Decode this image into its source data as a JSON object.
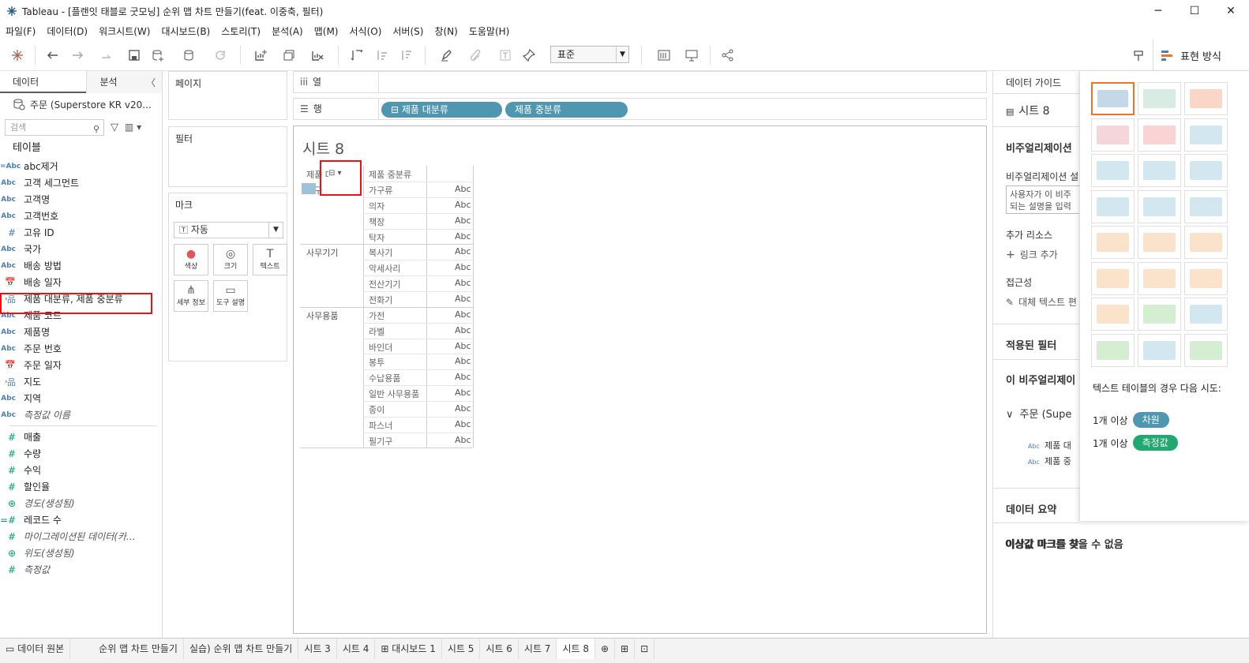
{
  "window": {
    "title": "Tableau - [플랜잇 태블로 굿모닝] 순위 맵 차트 만들기(feat. 이중축, 필터)",
    "controls": [
      "─",
      "☐",
      "✕"
    ]
  },
  "menu": [
    "파일(F)",
    "데이터(D)",
    "워크시트(W)",
    "대시보드(B)",
    "스토리(T)",
    "분석(A)",
    "맵(M)",
    "서식(O)",
    "서버(S)",
    "창(N)",
    "도움말(H)"
  ],
  "toolbar": {
    "fit_value": "표준",
    "show_me_label": "표현 방식"
  },
  "data_pane": {
    "tab_data": "데이터",
    "tab_analysis": "분석",
    "collapse": "〈",
    "datasource": "주문 (Superstore KR v20...",
    "search_placeholder": "검색",
    "tables_header": "테이블",
    "fields": [
      {
        "icon": "=Abc",
        "name": "abc제거",
        "kind": "dim"
      },
      {
        "icon": "Abc",
        "name": "고객 세그먼트",
        "kind": "dim"
      },
      {
        "icon": "Abc",
        "name": "고객명",
        "kind": "dim"
      },
      {
        "icon": "Abc",
        "name": "고객번호",
        "kind": "dim"
      },
      {
        "icon": "#",
        "name": "고유 ID",
        "kind": "dimnum"
      },
      {
        "icon": "Abc",
        "name": "국가",
        "kind": "dim"
      },
      {
        "icon": "Abc",
        "name": "배송 방법",
        "kind": "dim"
      },
      {
        "icon": "📅",
        "name": "배송 일자",
        "kind": "date"
      },
      {
        "icon": "品",
        "name": "제품 대분류, 제품 중분류",
        "kind": "hier"
      },
      {
        "icon": "Abc",
        "name": "제품 코드",
        "kind": "dim"
      },
      {
        "icon": "Abc",
        "name": "제품명",
        "kind": "dim"
      },
      {
        "icon": "Abc",
        "name": "주문 번호",
        "kind": "dim"
      },
      {
        "icon": "📅",
        "name": "주문 일자",
        "kind": "date"
      },
      {
        "icon": "品",
        "name": "지도",
        "kind": "hier"
      },
      {
        "icon": "Abc",
        "name": "지역",
        "kind": "dim"
      },
      {
        "icon": "Abc",
        "name": "측정값 이름",
        "kind": "italic"
      }
    ],
    "measures": [
      {
        "icon": "#",
        "name": "매출",
        "kind": "meas"
      },
      {
        "icon": "#",
        "name": "수량",
        "kind": "meas"
      },
      {
        "icon": "#",
        "name": "수익",
        "kind": "meas"
      },
      {
        "icon": "#",
        "name": "할인율",
        "kind": "meas"
      },
      {
        "icon": "⊕",
        "name": "경도(생성됨)",
        "kind": "measitalic"
      },
      {
        "icon": "=#",
        "name": "레코드 수",
        "kind": "meas"
      },
      {
        "icon": "#",
        "name": "마이그레이션된 데이터(카...",
        "kind": "measitalic"
      },
      {
        "icon": "⊕",
        "name": "위도(생성됨)",
        "kind": "measitalic"
      },
      {
        "icon": "#",
        "name": "측정값",
        "kind": "measitalic"
      }
    ]
  },
  "cards": {
    "pages": "페이지",
    "filters": "필터",
    "marks": "마크",
    "mark_type": "자동",
    "mark_buttons": [
      "색상",
      "크기",
      "텍스트",
      "세부 정보",
      "도구 설명"
    ]
  },
  "shelves": {
    "columns_label": "열",
    "rows_label": "행",
    "row_pills": [
      "⊟ 제품 대분류",
      "제품 중분류"
    ]
  },
  "view": {
    "sheet_title": "시트 8",
    "header_col1": "제품 대분류",
    "header_col2": "제품 중분류",
    "groups": [
      {
        "name": "가구",
        "items": [
          "가구류",
          "의자",
          "책장",
          "탁자"
        ]
      },
      {
        "name": "사무기기",
        "items": [
          "복사기",
          "악세사리",
          "전산기기",
          "전화기"
        ]
      },
      {
        "name": "사무용품",
        "items": [
          "가전",
          "라벨",
          "바인더",
          "봉투",
          "수납용품",
          "일반 사무용품",
          "종이",
          "파스너",
          "필기구"
        ]
      }
    ],
    "cell_text": "Abc"
  },
  "guide": {
    "title": "데이터 가이드",
    "sheet": "시트 8",
    "viz_desc_header": "비주얼리제이션",
    "viz_desc_sub": "비주얼리제이션 설",
    "desc_box_line1": "사용자가 이 비주",
    "desc_box_line2": "되는 설명을 입력",
    "resources": "추가 리소스",
    "add_link": "링크 추가",
    "accessibility": "접근성",
    "alt_text": "대체 텍스트 편",
    "applied_filters": "적용된 필터",
    "this_viz": "이 비주얼리제이",
    "source": "주문 (Supe",
    "field1": "제품 대",
    "field2": "제품 중",
    "data_summary": "데이터 요약",
    "outliers": "이상값 마크를 찾을 수 없음"
  },
  "show_me": {
    "hint": "텍스트 테이블의 경우 다음 시도:",
    "req1_prefix": "1개 이상",
    "req1_badge": "차원",
    "req2_prefix": "1개 이상",
    "req2_badge": "측정값",
    "dim_color": "#4f97b0",
    "meas_color": "#1fa971"
  },
  "bottom_tabs": [
    "데이터 원본",
    "순위 맵 차트 만들기",
    "실습) 순위 맵 차트 만들기",
    "시트 3",
    "시트 4",
    "대시보드 1",
    "시트 5",
    "시트 6",
    "시트 7",
    "시트 8"
  ],
  "active_tab": "시트 8"
}
